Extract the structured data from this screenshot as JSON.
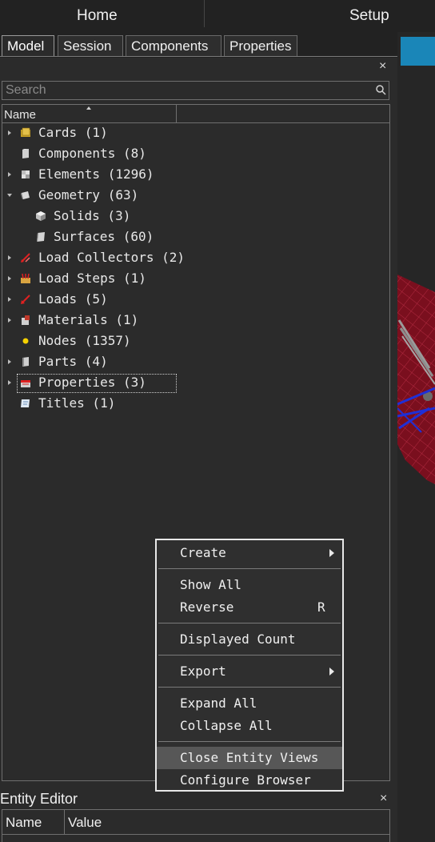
{
  "topbar": {
    "home": "Home",
    "setup": "Setup"
  },
  "tabs": [
    {
      "label": "Model",
      "active": true
    },
    {
      "label": "Session",
      "active": false
    },
    {
      "label": "Components",
      "active": false
    },
    {
      "label": "Properties",
      "active": false
    }
  ],
  "browser": {
    "close_glyph": "×",
    "search": {
      "placeholder": "Search",
      "value": ""
    },
    "columns": [
      "Name"
    ],
    "tree": [
      {
        "label": "Cards (1)",
        "expander": "collapsed",
        "icon": "cards-icon"
      },
      {
        "label": "Components (8)",
        "expander": "none",
        "icon": "components-icon"
      },
      {
        "label": "Elements (1296)",
        "expander": "collapsed",
        "icon": "elements-icon"
      },
      {
        "label": "Geometry (63)",
        "expander": "expanded",
        "icon": "geometry-icon"
      },
      {
        "label": "Solids (3)",
        "expander": "none",
        "icon": "solids-icon",
        "child": true
      },
      {
        "label": "Surfaces (60)",
        "expander": "none",
        "icon": "surfaces-icon",
        "child": true
      },
      {
        "label": "Load Collectors (2)",
        "expander": "collapsed",
        "icon": "load-collectors-icon"
      },
      {
        "label": "Load Steps (1)",
        "expander": "collapsed",
        "icon": "load-steps-icon"
      },
      {
        "label": "Loads (5)",
        "expander": "collapsed",
        "icon": "loads-icon"
      },
      {
        "label": "Materials (1)",
        "expander": "collapsed",
        "icon": "materials-icon"
      },
      {
        "label": "Nodes (1357)",
        "expander": "none",
        "icon": "nodes-icon"
      },
      {
        "label": "Parts (4)",
        "expander": "collapsed",
        "icon": "parts-icon"
      },
      {
        "label": "Properties (3)",
        "expander": "collapsed",
        "icon": "properties-icon",
        "selected": true
      },
      {
        "label": "Titles (1)",
        "expander": "none",
        "icon": "titles-icon"
      }
    ]
  },
  "context_menu": {
    "items": [
      {
        "label": "Create",
        "submenu": true
      },
      {
        "label": "Show All"
      },
      {
        "label": "Reverse",
        "shortcut": "R"
      },
      {
        "label": "Displayed Count"
      },
      {
        "label": "Export",
        "submenu": true
      },
      {
        "label": "Expand All"
      },
      {
        "label": "Collapse All"
      },
      {
        "label": "Close Entity Views",
        "hover": true
      },
      {
        "label": "Configure Browser"
      }
    ]
  },
  "entity_editor": {
    "title": "Entity Editor",
    "close_glyph": "×",
    "columns": [
      "Name",
      "Value"
    ]
  },
  "colors": {
    "accent": "#1a86b8",
    "background": "#2b2b2b",
    "model_red": "#7a0f1e",
    "model_blue": "#1f2fd6"
  }
}
